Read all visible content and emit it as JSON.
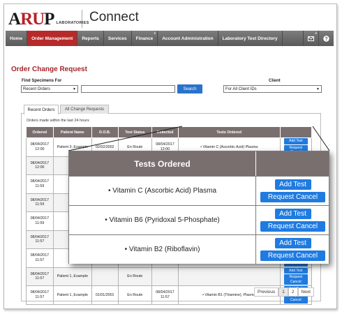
{
  "header": {
    "logo_prefix": "A",
    "logo_mid": "RU",
    "logo_suffix": "P",
    "logo_sub": "LABORATORIES",
    "app_name": "Connect"
  },
  "nav": {
    "items": [
      {
        "label": "Home",
        "active": false
      },
      {
        "label": "Order Management",
        "active": true
      },
      {
        "label": "Reports",
        "active": false
      },
      {
        "label": "Services",
        "active": false
      },
      {
        "label": "Finance",
        "active": false,
        "badge": "6"
      },
      {
        "label": "Account Administration",
        "active": false
      },
      {
        "label": "Laboratory Test Directory",
        "active": false
      }
    ],
    "mail_badge": "5",
    "mail_icon": "mail-icon",
    "help_icon": "help-icon"
  },
  "page": {
    "title": "Order Change Request",
    "find_label": "Find Specimens For",
    "find_value": "Recent Orders",
    "search_value": "",
    "search_button": "Search",
    "client_label": "Client",
    "client_value": "For All Client IDs"
  },
  "tabs": [
    {
      "label": "Recent Orders",
      "active": true
    },
    {
      "label": "All Change Requests",
      "active": false
    }
  ],
  "note": "Orders made within the last 24 hours",
  "table": {
    "headers": [
      "Ordered",
      "Patient Name",
      "D.O.B.",
      "Test Status",
      "Collected",
      "Tests Ordered",
      ""
    ],
    "rows": [
      [
        "08/04/2017 12:00",
        "Patient 3, Example",
        "02/02/2002",
        "En Route",
        "08/04/2017 12:00",
        "• Vitamin C (Ascorbic Acid) Plasma"
      ],
      [
        "08/04/2017 12:00",
        "",
        "",
        "",
        "",
        ""
      ],
      [
        "08/04/2017 11:59",
        "",
        "",
        "",
        "",
        ""
      ],
      [
        "08/04/2017 11:59",
        "",
        "",
        "",
        "",
        ""
      ],
      [
        "08/04/2017 11:59",
        "",
        "",
        "",
        "",
        ""
      ],
      [
        "08/04/2017 11:57",
        "",
        "",
        "",
        "",
        ""
      ],
      [
        "08/04/2017 11:57",
        "",
        "",
        "",
        "",
        ""
      ],
      [
        "08/04/2017 11:57",
        "Patient 1, Example",
        "",
        "En Route",
        "",
        ""
      ],
      [
        "08/04/2017 11:57",
        "Patient 1, Example",
        "01/01/2001",
        "En Route",
        "08/04/2017 11:57",
        "• Vitamin B1 (Thiamine), Plasma"
      ]
    ],
    "add_test": "Add Test",
    "request_cancel": "Request Cancel"
  },
  "pager": {
    "previous": "Previous",
    "pages": [
      "1",
      "2"
    ],
    "next": "Next"
  },
  "zoom": {
    "header": "Tests Ordered",
    "rows": [
      {
        "test": "• Vitamin C (Ascorbic Acid) Plasma"
      },
      {
        "test": "• Vitamin B6 (Pyridoxal 5-Phosphate)"
      },
      {
        "test": "• Vitamin B2 (Riboflavin)"
      }
    ],
    "add_test": "Add Test",
    "request_cancel": "Request Cancel"
  }
}
